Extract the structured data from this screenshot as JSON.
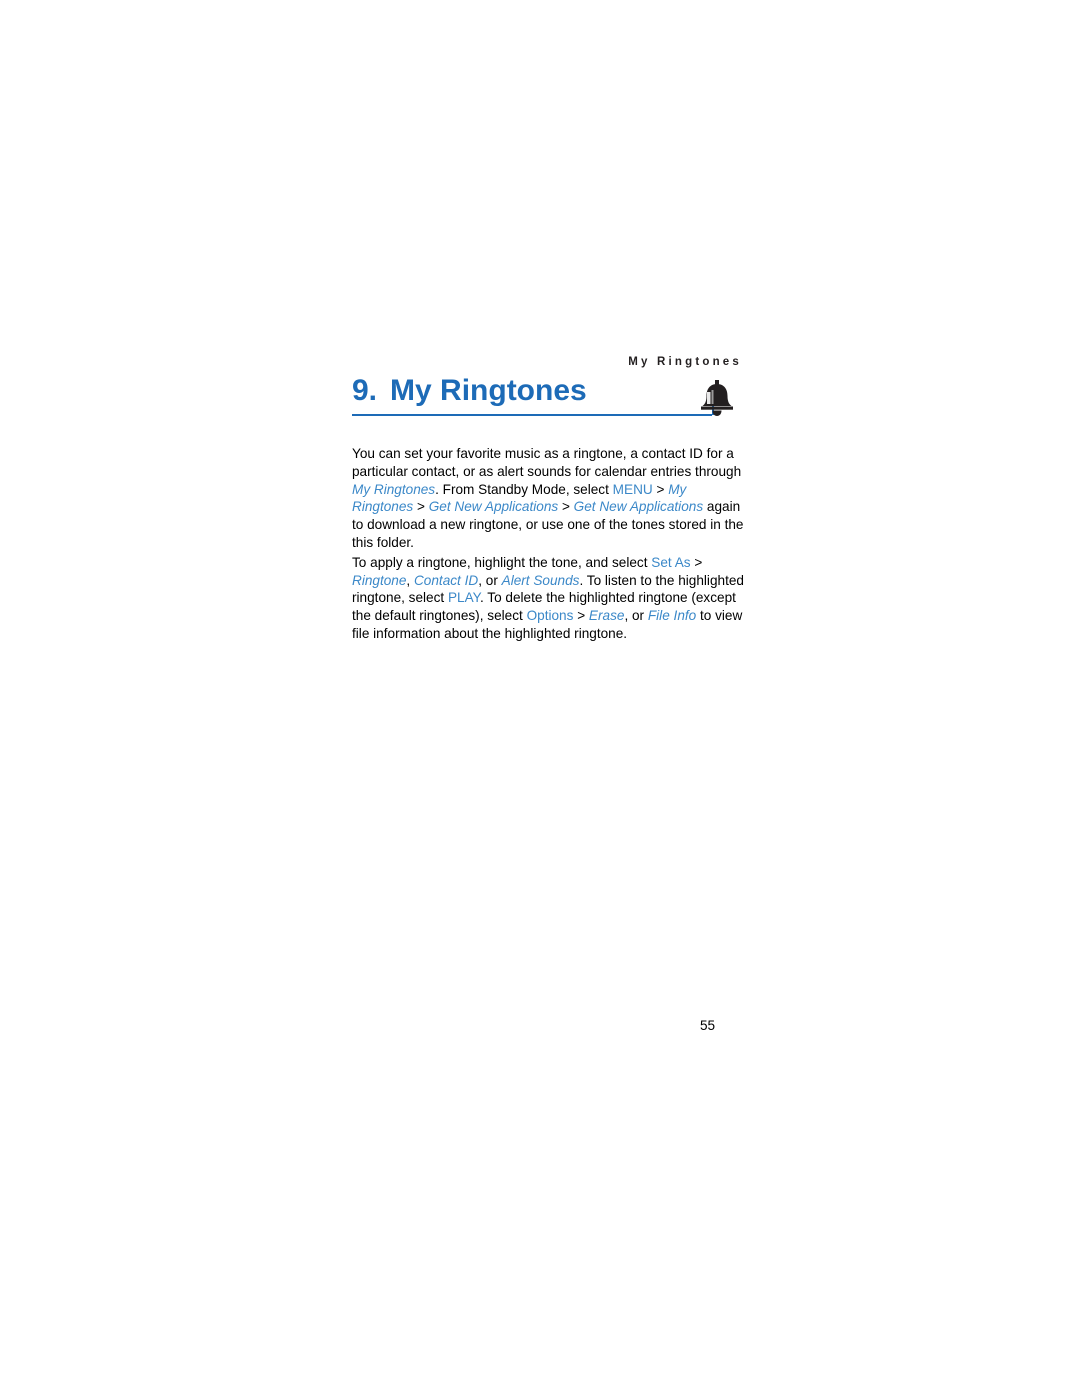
{
  "page": {
    "running_head": "My Ringtones",
    "page_number": "55"
  },
  "chapter": {
    "number": "9.",
    "title": "My Ringtones",
    "icon": "bell-icon"
  },
  "content": {
    "paragraph_1": {
      "segment_1": "You can set your favorite music as a ringtone, a contact ID for a particular contact, or as alert sounds for calendar entries through ",
      "link_1": "My Ringtones",
      "segment_2": ". From Standby Mode, select ",
      "link_2": "MENU",
      "segment_3": " > ",
      "link_3": "My Ringtones",
      "segment_4": " > ",
      "link_4": "Get New Applications",
      "segment_5": " > ",
      "link_5": "Get New Applications",
      "segment_6": " again to download a new ringtone, or use one of the tones stored in the this folder."
    },
    "paragraph_2": {
      "segment_1": "To apply a ringtone, highlight the tone, and select ",
      "link_1": "Set As",
      "segment_2": " > ",
      "link_2": "Ringtone",
      "segment_3": ", ",
      "link_3": "Contact ID",
      "segment_4": ", or ",
      "link_4": "Alert Sounds",
      "segment_5": ". To listen to the highlighted ringtone, select ",
      "link_5": "PLAY",
      "segment_6": ". To delete the highlighted ringtone (except the default ringtones), select ",
      "link_6": "Options",
      "segment_7": " > ",
      "link_7": "Erase",
      "segment_8": ", or ",
      "link_8": "File Info",
      "segment_9": " to view file information about the highlighted ringtone."
    }
  },
  "colors": {
    "accent": "#1d6bb7",
    "link": "#3b88c8",
    "text": "#000000"
  }
}
